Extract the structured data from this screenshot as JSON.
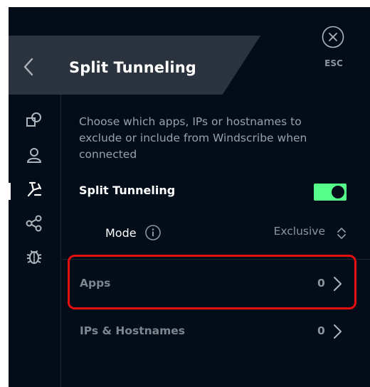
{
  "header": {
    "title": "Split Tunneling",
    "esc_label": "ESC"
  },
  "sidebar": {
    "items": [
      {
        "icon": "connection-icon"
      },
      {
        "icon": "account-icon"
      },
      {
        "icon": "split-tunneling-icon",
        "active": true
      },
      {
        "icon": "share-icon"
      },
      {
        "icon": "debug-icon"
      }
    ]
  },
  "content": {
    "description": "Choose which apps, IPs or hostnames to exclude or include from Windscribe when connected",
    "split_tunneling": {
      "label": "Split Tunneling",
      "enabled": true
    },
    "mode": {
      "label": "Mode",
      "value": "Exclusive"
    },
    "apps": {
      "label": "Apps",
      "count": "0"
    },
    "ips": {
      "label": "IPs & Hostnames",
      "count": "0"
    }
  },
  "colors": {
    "background": "#030d1a",
    "header": "#2b333e",
    "toggle_on": "#55ff8a",
    "highlight": "#e60f0f"
  }
}
